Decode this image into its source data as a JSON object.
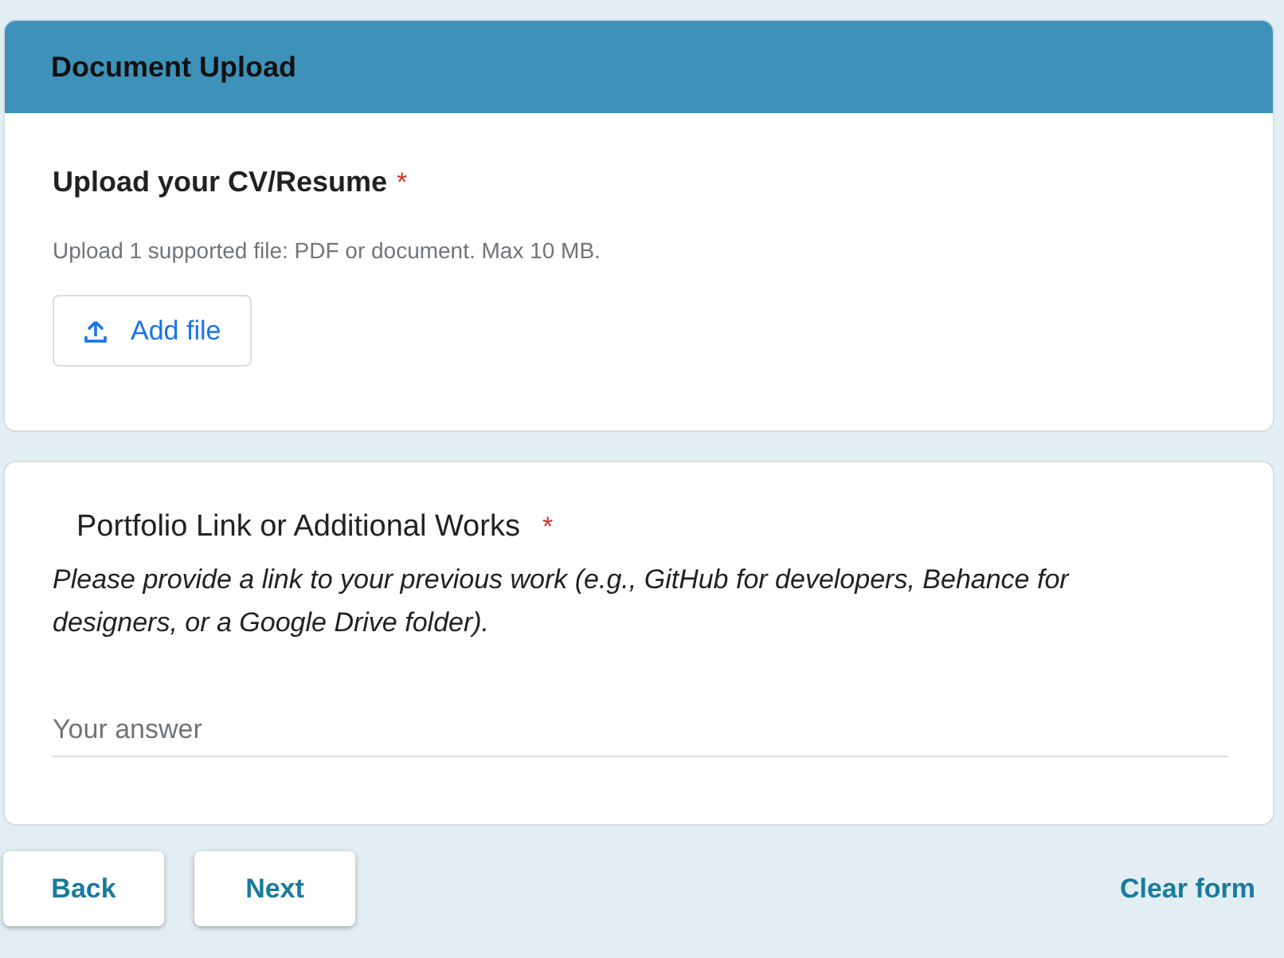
{
  "section_header": {
    "title": "Document Upload"
  },
  "upload_question": {
    "title": "Upload your CV/Resume",
    "required_mark": "*",
    "hint": "Upload 1 supported file: PDF or document. Max 10 MB.",
    "button": "Add file"
  },
  "text_question": {
    "title": "Portfolio Link or Additional Works",
    "required_mark": "*",
    "description": "Please provide a link to your previous work (e.g., GitHub for developers, Behance for designers, or a Google Drive folder).",
    "placeholder": "Your answer"
  },
  "buttons": [
    {
      "label": "Back"
    },
    {
      "label": "Next"
    }
  ],
  "clear_link": "Clear form"
}
